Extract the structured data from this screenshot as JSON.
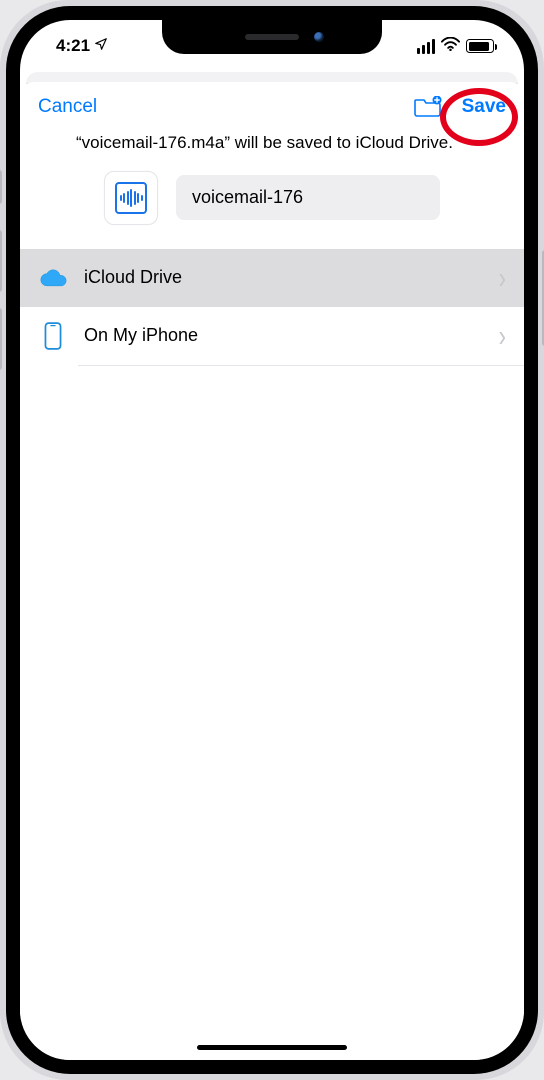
{
  "status_bar": {
    "time": "4:21"
  },
  "nav": {
    "cancel_label": "Cancel",
    "save_label": "Save"
  },
  "prompt": {
    "text": "“voicemail-176.m4a” will be saved to iCloud Drive."
  },
  "file": {
    "name_value": "voicemail-176"
  },
  "locations": [
    {
      "label": "iCloud Drive",
      "icon": "cloud-icon",
      "selected": true
    },
    {
      "label": "On My iPhone",
      "icon": "iphone-icon",
      "selected": false
    }
  ]
}
